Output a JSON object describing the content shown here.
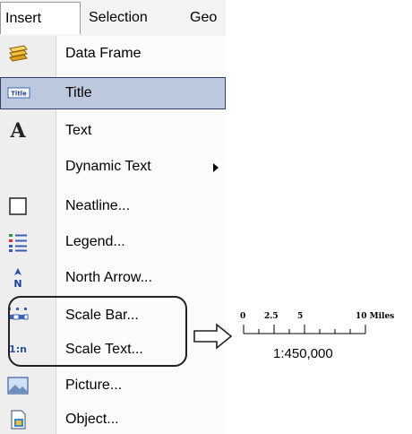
{
  "menubar": {
    "tabs": [
      {
        "label": "Insert",
        "active": true
      },
      {
        "label": "Selection",
        "active": false
      },
      {
        "label": "Geo",
        "active": false
      }
    ]
  },
  "menu": {
    "items": [
      {
        "label": "Data Frame",
        "icon": "data-frame-icon"
      },
      {
        "label": "Title",
        "icon": "title-icon",
        "highlighted": true
      },
      {
        "label": "Text",
        "icon": "text-a-icon"
      },
      {
        "label": "Dynamic Text",
        "icon": "none",
        "submenu": true
      },
      {
        "label": "Neatline...",
        "icon": "neatline-icon"
      },
      {
        "label": "Legend...",
        "icon": "legend-icon"
      },
      {
        "label": "North Arrow...",
        "icon": "north-arrow-icon"
      },
      {
        "label": "Scale Bar...",
        "icon": "scale-bar-icon"
      },
      {
        "label": "Scale Text...",
        "icon": "scale-text-icon"
      },
      {
        "label": "Picture...",
        "icon": "picture-icon"
      },
      {
        "label": "Object...",
        "icon": "object-icon"
      }
    ],
    "title_icon_text": "Title",
    "text_icon_glyph": "A",
    "north_icon_letter": "N",
    "scale_text_icon_text": "1:n"
  },
  "scale_sample": {
    "tick_labels": [
      "0",
      "2.5",
      "5",
      "10 Miles"
    ],
    "scale_text": "1:450,000"
  },
  "colors": {
    "highlight_bg": "#bcc8de",
    "highlight_border": "#2d3f69",
    "gutter": "#eeeeee"
  }
}
